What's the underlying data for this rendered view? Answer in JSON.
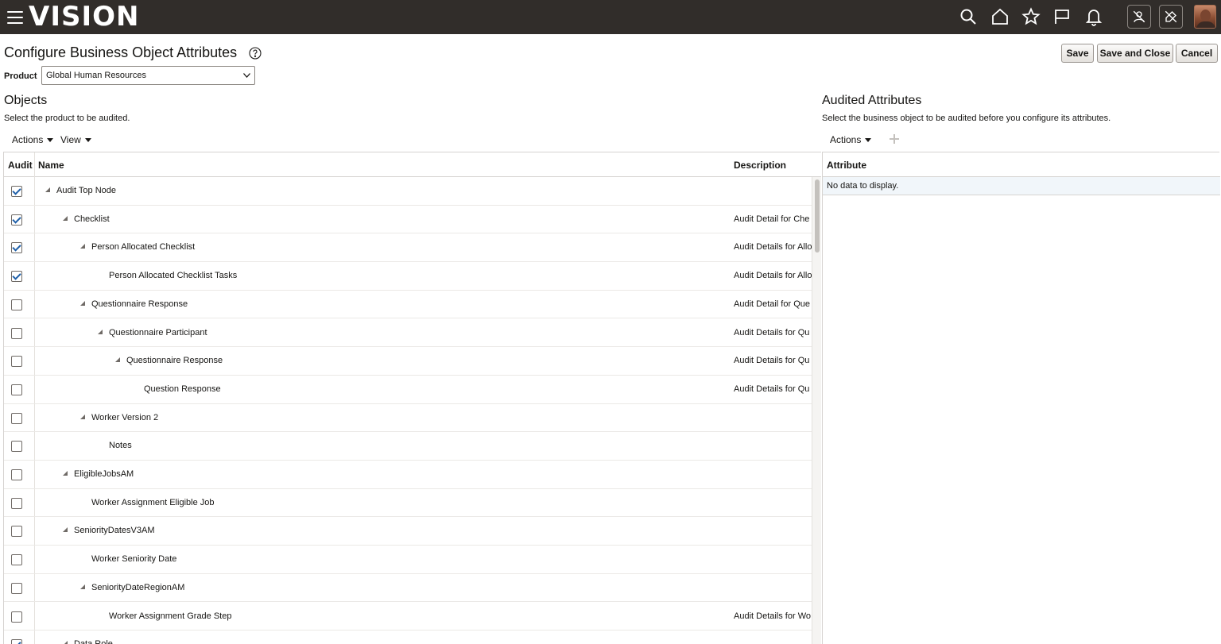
{
  "app": {
    "logo_text": "VISION"
  },
  "topbar": {
    "icons": [
      "menu-icon",
      "search-icon",
      "home-icon",
      "star-icon",
      "flag-icon",
      "bell-icon",
      "person-off-icon",
      "tool-off-icon",
      "user-avatar"
    ]
  },
  "page": {
    "title": "Configure Business Object Attributes"
  },
  "toolbar": {
    "save_label": "Save",
    "save_close_label": "Save and Close",
    "cancel_label": "Cancel"
  },
  "product": {
    "label": "Product",
    "selected": "Global Human Resources"
  },
  "objects": {
    "title": "Objects",
    "subtitle": "Select the product to be audited.",
    "actions_label": "Actions",
    "view_label": "View",
    "columns": {
      "audit": "Audit",
      "name": "Name",
      "description": "Description"
    },
    "rows": [
      {
        "checked": true,
        "level": 0,
        "expandable": true,
        "name": "Audit Top Node",
        "description": ""
      },
      {
        "checked": true,
        "level": 1,
        "expandable": true,
        "name": "Checklist",
        "description": "Audit Detail for Che"
      },
      {
        "checked": true,
        "level": 2,
        "expandable": true,
        "name": "Person Allocated Checklist",
        "description": "Audit Details for Allo"
      },
      {
        "checked": true,
        "level": 3,
        "expandable": false,
        "name": "Person Allocated Checklist Tasks",
        "description": "Audit Details for Allo"
      },
      {
        "checked": false,
        "level": 2,
        "expandable": true,
        "name": "Questionnaire Response",
        "description": "Audit Detail for Que"
      },
      {
        "checked": false,
        "level": 3,
        "expandable": true,
        "name": "Questionnaire Participant",
        "description": "Audit Details for Qu"
      },
      {
        "checked": false,
        "level": 4,
        "expandable": true,
        "name": "Questionnaire Response",
        "description": "Audit Details for Qu"
      },
      {
        "checked": false,
        "level": 5,
        "expandable": false,
        "name": "Question Response",
        "description": "Audit Details for Qu"
      },
      {
        "checked": false,
        "level": 2,
        "expandable": true,
        "name": "Worker Version 2",
        "description": ""
      },
      {
        "checked": false,
        "level": 3,
        "expandable": false,
        "name": "Notes",
        "description": ""
      },
      {
        "checked": false,
        "level": 1,
        "expandable": true,
        "name": "EligibleJobsAM",
        "description": ""
      },
      {
        "checked": false,
        "level": 2,
        "expandable": false,
        "name": "Worker Assignment Eligible Job",
        "description": ""
      },
      {
        "checked": false,
        "level": 1,
        "expandable": true,
        "name": "SeniorityDatesV3AM",
        "description": ""
      },
      {
        "checked": false,
        "level": 2,
        "expandable": false,
        "name": "Worker Seniority Date",
        "description": ""
      },
      {
        "checked": false,
        "level": 2,
        "expandable": true,
        "name": "SeniorityDateRegionAM",
        "description": ""
      },
      {
        "checked": false,
        "level": 3,
        "expandable": false,
        "name": "Worker Assignment Grade Step",
        "description": "Audit Details for Wo"
      },
      {
        "checked": true,
        "level": 1,
        "expandable": true,
        "name": "Data Role",
        "description": ""
      }
    ]
  },
  "audited": {
    "title": "Audited Attributes",
    "subtitle": "Select the business object to be audited before you configure its attributes.",
    "actions_label": "Actions",
    "column": "Attribute",
    "empty_text": "No data to display."
  }
}
